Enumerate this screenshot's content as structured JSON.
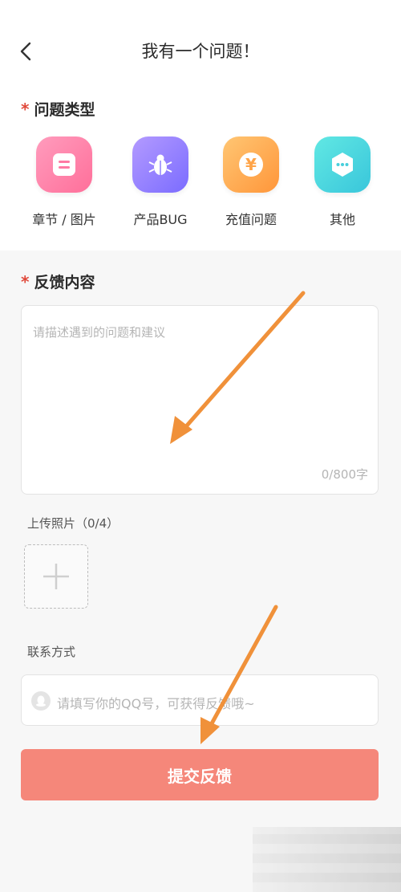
{
  "header": {
    "title": "我有一个问题！"
  },
  "problem_type": {
    "star": "*",
    "title": "问题类型",
    "items": [
      {
        "label": "章节 / 图片",
        "icon": "chapter-icon",
        "colors": [
          "#ff8fb3",
          "#ff6f9a"
        ]
      },
      {
        "label": "产品BUG",
        "icon": "bug-icon",
        "colors": [
          "#a88bff",
          "#7b6cff"
        ]
      },
      {
        "label": "充值问题",
        "icon": "yen-coin-icon",
        "colors": [
          "#ffc06b",
          "#ff9a3e"
        ]
      },
      {
        "label": "其他",
        "icon": "more-icon",
        "colors": [
          "#58e4e0",
          "#3bc9dc"
        ]
      }
    ]
  },
  "feedback": {
    "star": "*",
    "title": "反馈内容",
    "placeholder": "请描述遇到的问题和建议",
    "counter": "0/800字"
  },
  "upload": {
    "label": "上传照片（0/4）"
  },
  "contact": {
    "label": "联系方式",
    "placeholder": "请填写你的QQ号，可获得反馈哦~"
  },
  "submit": {
    "label": "提交反馈",
    "color": "#f5877a"
  },
  "annotation_color": "#f0913a"
}
